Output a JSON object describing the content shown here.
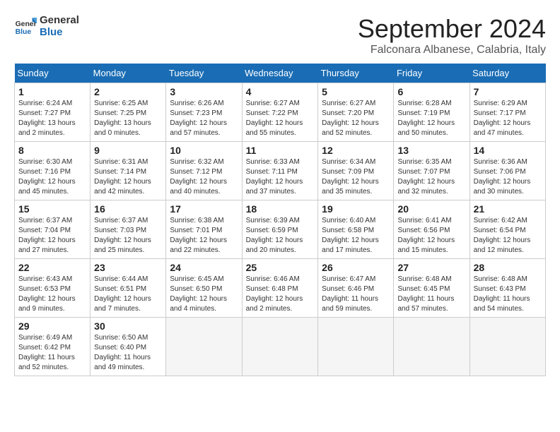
{
  "header": {
    "logo_general": "General",
    "logo_blue": "Blue",
    "month_title": "September 2024",
    "location": "Falconara Albanese, Calabria, Italy"
  },
  "calendar": {
    "days_of_week": [
      "Sunday",
      "Monday",
      "Tuesday",
      "Wednesday",
      "Thursday",
      "Friday",
      "Saturday"
    ],
    "weeks": [
      [
        null,
        null,
        null,
        {
          "day": "1",
          "sunrise": "Sunrise: 6:24 AM",
          "sunset": "Sunset: 7:27 PM",
          "daylight": "Daylight: 13 hours and 2 minutes."
        },
        {
          "day": "5",
          "sunrise": "Sunrise: 6:27 AM",
          "sunset": "Sunset: 7:20 PM",
          "daylight": "Daylight: 12 hours and 52 minutes."
        },
        {
          "day": "6",
          "sunrise": "Sunrise: 6:28 AM",
          "sunset": "Sunset: 7:19 PM",
          "daylight": "Daylight: 12 hours and 50 minutes."
        },
        {
          "day": "7",
          "sunrise": "Sunrise: 6:29 AM",
          "sunset": "Sunset: 7:17 PM",
          "daylight": "Daylight: 12 hours and 47 minutes."
        }
      ]
    ],
    "rows": [
      [
        {
          "day": "1",
          "sunrise": "Sunrise: 6:24 AM",
          "sunset": "Sunset: 7:27 PM",
          "daylight": "Daylight: 13 hours and 2 minutes."
        },
        {
          "day": "2",
          "sunrise": "Sunrise: 6:25 AM",
          "sunset": "Sunset: 7:25 PM",
          "daylight": "Daylight: 13 hours and 0 minutes."
        },
        {
          "day": "3",
          "sunrise": "Sunrise: 6:26 AM",
          "sunset": "Sunset: 7:23 PM",
          "daylight": "Daylight: 12 hours and 57 minutes."
        },
        {
          "day": "4",
          "sunrise": "Sunrise: 6:27 AM",
          "sunset": "Sunset: 7:22 PM",
          "daylight": "Daylight: 12 hours and 55 minutes."
        },
        {
          "day": "5",
          "sunrise": "Sunrise: 6:27 AM",
          "sunset": "Sunset: 7:20 PM",
          "daylight": "Daylight: 12 hours and 52 minutes."
        },
        {
          "day": "6",
          "sunrise": "Sunrise: 6:28 AM",
          "sunset": "Sunset: 7:19 PM",
          "daylight": "Daylight: 12 hours and 50 minutes."
        },
        {
          "day": "7",
          "sunrise": "Sunrise: 6:29 AM",
          "sunset": "Sunset: 7:17 PM",
          "daylight": "Daylight: 12 hours and 47 minutes."
        }
      ],
      [
        {
          "day": "8",
          "sunrise": "Sunrise: 6:30 AM",
          "sunset": "Sunset: 7:16 PM",
          "daylight": "Daylight: 12 hours and 45 minutes."
        },
        {
          "day": "9",
          "sunrise": "Sunrise: 6:31 AM",
          "sunset": "Sunset: 7:14 PM",
          "daylight": "Daylight: 12 hours and 42 minutes."
        },
        {
          "day": "10",
          "sunrise": "Sunrise: 6:32 AM",
          "sunset": "Sunset: 7:12 PM",
          "daylight": "Daylight: 12 hours and 40 minutes."
        },
        {
          "day": "11",
          "sunrise": "Sunrise: 6:33 AM",
          "sunset": "Sunset: 7:11 PM",
          "daylight": "Daylight: 12 hours and 37 minutes."
        },
        {
          "day": "12",
          "sunrise": "Sunrise: 6:34 AM",
          "sunset": "Sunset: 7:09 PM",
          "daylight": "Daylight: 12 hours and 35 minutes."
        },
        {
          "day": "13",
          "sunrise": "Sunrise: 6:35 AM",
          "sunset": "Sunset: 7:07 PM",
          "daylight": "Daylight: 12 hours and 32 minutes."
        },
        {
          "day": "14",
          "sunrise": "Sunrise: 6:36 AM",
          "sunset": "Sunset: 7:06 PM",
          "daylight": "Daylight: 12 hours and 30 minutes."
        }
      ],
      [
        {
          "day": "15",
          "sunrise": "Sunrise: 6:37 AM",
          "sunset": "Sunset: 7:04 PM",
          "daylight": "Daylight: 12 hours and 27 minutes."
        },
        {
          "day": "16",
          "sunrise": "Sunrise: 6:37 AM",
          "sunset": "Sunset: 7:03 PM",
          "daylight": "Daylight: 12 hours and 25 minutes."
        },
        {
          "day": "17",
          "sunrise": "Sunrise: 6:38 AM",
          "sunset": "Sunset: 7:01 PM",
          "daylight": "Daylight: 12 hours and 22 minutes."
        },
        {
          "day": "18",
          "sunrise": "Sunrise: 6:39 AM",
          "sunset": "Sunset: 6:59 PM",
          "daylight": "Daylight: 12 hours and 20 minutes."
        },
        {
          "day": "19",
          "sunrise": "Sunrise: 6:40 AM",
          "sunset": "Sunset: 6:58 PM",
          "daylight": "Daylight: 12 hours and 17 minutes."
        },
        {
          "day": "20",
          "sunrise": "Sunrise: 6:41 AM",
          "sunset": "Sunset: 6:56 PM",
          "daylight": "Daylight: 12 hours and 15 minutes."
        },
        {
          "day": "21",
          "sunrise": "Sunrise: 6:42 AM",
          "sunset": "Sunset: 6:54 PM",
          "daylight": "Daylight: 12 hours and 12 minutes."
        }
      ],
      [
        {
          "day": "22",
          "sunrise": "Sunrise: 6:43 AM",
          "sunset": "Sunset: 6:53 PM",
          "daylight": "Daylight: 12 hours and 9 minutes."
        },
        {
          "day": "23",
          "sunrise": "Sunrise: 6:44 AM",
          "sunset": "Sunset: 6:51 PM",
          "daylight": "Daylight: 12 hours and 7 minutes."
        },
        {
          "day": "24",
          "sunrise": "Sunrise: 6:45 AM",
          "sunset": "Sunset: 6:50 PM",
          "daylight": "Daylight: 12 hours and 4 minutes."
        },
        {
          "day": "25",
          "sunrise": "Sunrise: 6:46 AM",
          "sunset": "Sunset: 6:48 PM",
          "daylight": "Daylight: 12 hours and 2 minutes."
        },
        {
          "day": "26",
          "sunrise": "Sunrise: 6:47 AM",
          "sunset": "Sunset: 6:46 PM",
          "daylight": "Daylight: 11 hours and 59 minutes."
        },
        {
          "day": "27",
          "sunrise": "Sunrise: 6:48 AM",
          "sunset": "Sunset: 6:45 PM",
          "daylight": "Daylight: 11 hours and 57 minutes."
        },
        {
          "day": "28",
          "sunrise": "Sunrise: 6:48 AM",
          "sunset": "Sunset: 6:43 PM",
          "daylight": "Daylight: 11 hours and 54 minutes."
        }
      ],
      [
        {
          "day": "29",
          "sunrise": "Sunrise: 6:49 AM",
          "sunset": "Sunset: 6:42 PM",
          "daylight": "Daylight: 11 hours and 52 minutes."
        },
        {
          "day": "30",
          "sunrise": "Sunrise: 6:50 AM",
          "sunset": "Sunset: 6:40 PM",
          "daylight": "Daylight: 11 hours and 49 minutes."
        },
        null,
        null,
        null,
        null,
        null
      ]
    ]
  }
}
